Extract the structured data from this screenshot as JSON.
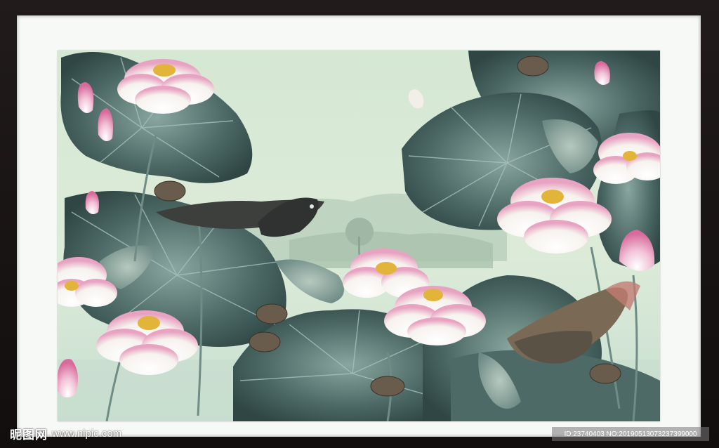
{
  "artwork": {
    "subject": "lotus-pond-with-koi",
    "colors": {
      "frame": "#1a1616",
      "mat": "#f7f9f7",
      "sky": "#d9ead9",
      "leaf_dark": "#3f5a57",
      "leaf_mid": "#6f8f8a",
      "lotus_white": "#fbf8f4",
      "lotus_pink": "#e48fb4",
      "stamen": "#e2b43a",
      "koi": "#3b3d3a"
    }
  },
  "watermark": {
    "brand": "昵图网",
    "url": "www.nipic.com",
    "id_text": "ID:23740403 NO:20190513073237399000"
  }
}
